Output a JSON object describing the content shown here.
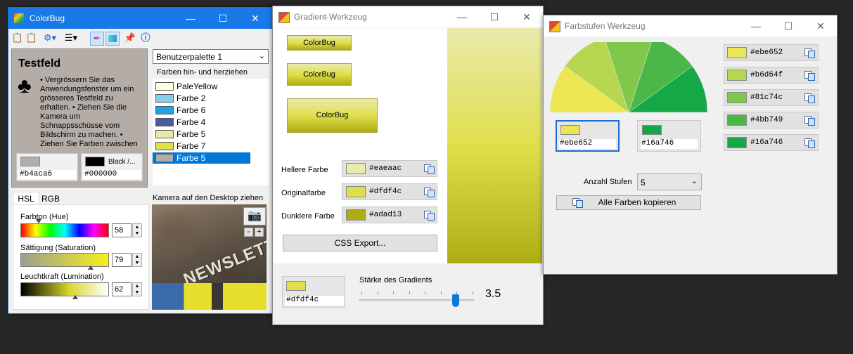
{
  "colorbug": {
    "title": "ColorBug",
    "testfeld": {
      "heading": "Testfeld",
      "text": "• Vergrössern Sie das Anwendungsfenster um ein grösseres Testfeld zu erhalten. • Ziehen Sie die Kamera um Schnappsschüsse vom Bildschirm zu machen. • Ziehen Sie Farben zwischen",
      "swatch1_name": "",
      "swatch1_hex": "#b4aca6",
      "swatch1_color": "#b4aca6",
      "swatch2_name": "Black /...",
      "swatch2_hex": "#000000",
      "swatch2_color": "#000000"
    },
    "palette": {
      "selected": "Benutzerpalette 1",
      "hint": "Farben hin- und herziehen",
      "items": [
        {
          "label": "PaleYellow",
          "color": "#ffffe0"
        },
        {
          "label": "Farbe 2",
          "color": "#87ceeb"
        },
        {
          "label": "Farbe 6",
          "color": "#1fa2e8"
        },
        {
          "label": "Farbe 4",
          "color": "#4a5aa0"
        },
        {
          "label": "Farbe 5",
          "color": "#eae8a4"
        },
        {
          "label": "Farbe 7",
          "color": "#dfdf4c"
        },
        {
          "label": "Farbe 5",
          "color": "#b4aca6"
        }
      ]
    },
    "tabs": {
      "hsl": "HSL",
      "rgb": "RGB"
    },
    "hsl": {
      "hue_label": "Farbton (Hue)",
      "hue_value": "58",
      "sat_label": "Sättigung (Saturation)",
      "sat_value": "79",
      "lum_label": "Leuchtkraft (Lumination)",
      "lum_value": "62"
    },
    "camera": {
      "label": "Kamera auf den Desktop ziehen",
      "minus": "-",
      "plus": "+",
      "overlay_text": "NEWSLETTER"
    }
  },
  "gradient": {
    "title": "Gradient-Werkzeug",
    "button_label": "ColorBug",
    "lighter_label": "Hellere Farbe",
    "lighter_hex": "#eaeaac",
    "lighter_color": "#eaeaac",
    "original_label": "Originalfarbe",
    "original_hex": "#dfdf4c",
    "original_color": "#dfdf4c",
    "darker_label": "Dunklere Farbe",
    "darker_hex": "#adad13",
    "darker_color": "#adad13",
    "css_export": "CSS Export...",
    "current_hex": "#dfdf4c",
    "strength_label": "Stärke des Gradients",
    "strength_value": "3.5"
  },
  "farbstufen": {
    "title": "Farbstufen Werkzeug",
    "left_hex": "#ebe652",
    "left_color": "#ebe652",
    "right_hex": "#16a746",
    "right_color": "#16a746",
    "steps_label": "Anzahl Stufen",
    "steps_value": "5",
    "copy_all": "Alle Farben kopieren",
    "colors": [
      {
        "hex": "#ebe652",
        "color": "#ebe652"
      },
      {
        "hex": "#b6d64f",
        "color": "#b6d64f"
      },
      {
        "hex": "#81c74c",
        "color": "#81c74c"
      },
      {
        "hex": "#4bb749",
        "color": "#4bb749"
      },
      {
        "hex": "#16a746",
        "color": "#16a746"
      }
    ]
  }
}
